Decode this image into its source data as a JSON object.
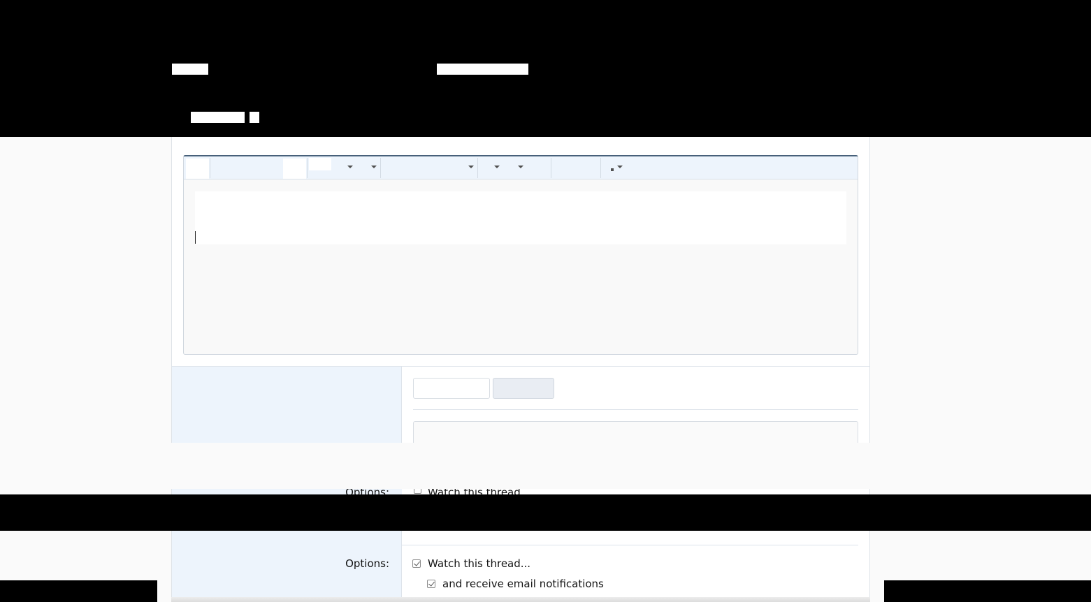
{
  "options": {
    "label": "Options:",
    "watch_thread_label": "Watch this thread...",
    "email_notifications_label": "and receive email notifications",
    "watch_thread_checked": true,
    "email_notifications_checked": true
  },
  "ghost_row": {
    "label": "Options:",
    "watch_thread_label": "Watch this thread..."
  },
  "colors": {
    "label_column_bg": "#edf4fc",
    "toolbar_bg": "#edf4fc",
    "editor_top_border": "#47607a",
    "redaction": "#000000"
  },
  "icons": [
    "chevron-down-icon",
    "checkbox-checked-icon"
  ]
}
